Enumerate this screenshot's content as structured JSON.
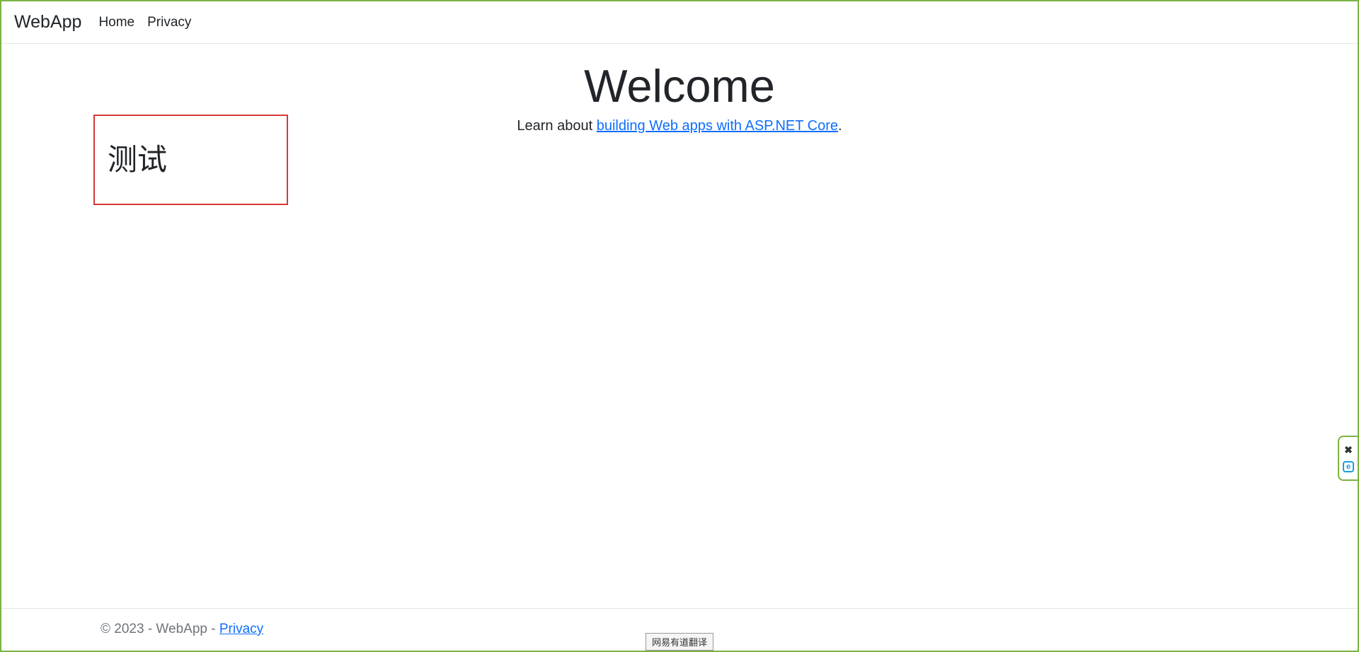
{
  "navbar": {
    "brand": "WebApp",
    "links": [
      {
        "label": "Home"
      },
      {
        "label": "Privacy"
      }
    ]
  },
  "main": {
    "title": "Welcome",
    "subtitle_prefix": "Learn about ",
    "subtitle_link": "building Web apps with ASP.NET Core",
    "subtitle_suffix": "."
  },
  "test_box": {
    "text": "测试"
  },
  "footer": {
    "copyright": "© 2023 - WebApp - ",
    "privacy_link": "Privacy"
  },
  "translate_widget": {
    "label": "网易有道翻译"
  },
  "side_widget": {
    "close_glyph": "✖",
    "e_label": "e"
  }
}
